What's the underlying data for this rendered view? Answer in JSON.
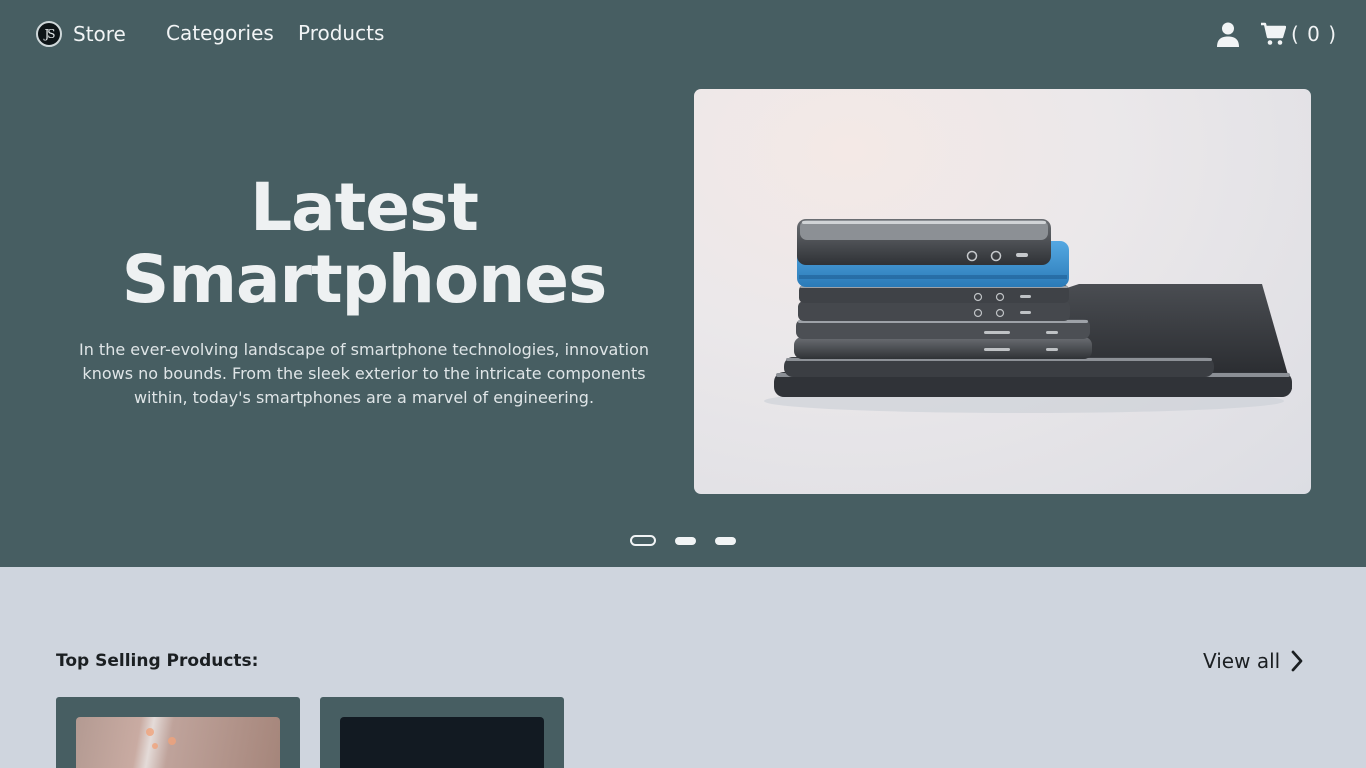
{
  "header": {
    "logo_text": "JS",
    "brand": "Store",
    "nav": {
      "categories": "Categories",
      "products": "Products"
    },
    "cart_count": "( 0 )"
  },
  "hero": {
    "title_line1": "Latest",
    "title_line2": "Smartphones",
    "description": "In the ever-evolving landscape of smartphone technologies, innovation knows no bounds. From the sleek exterior to the intricate components within, today's smartphones are a marvel of engineering.",
    "image": "stacked-smartphones-photo",
    "slides_total": 3,
    "active_slide": 1
  },
  "products_section": {
    "title": "Top Selling Products:",
    "view_all": "View all",
    "cards": [
      {
        "image": "product-photo-1"
      },
      {
        "image": "product-photo-2"
      }
    ]
  },
  "colors": {
    "hero_bg": "#475e62",
    "page_bg": "#cfd5de",
    "text_light": "#f1f4f5",
    "text_dark": "#1b1f22",
    "phone_blue": "#3b8ccc"
  },
  "icons": [
    "user-icon",
    "cart-icon",
    "chevron-right-icon"
  ]
}
